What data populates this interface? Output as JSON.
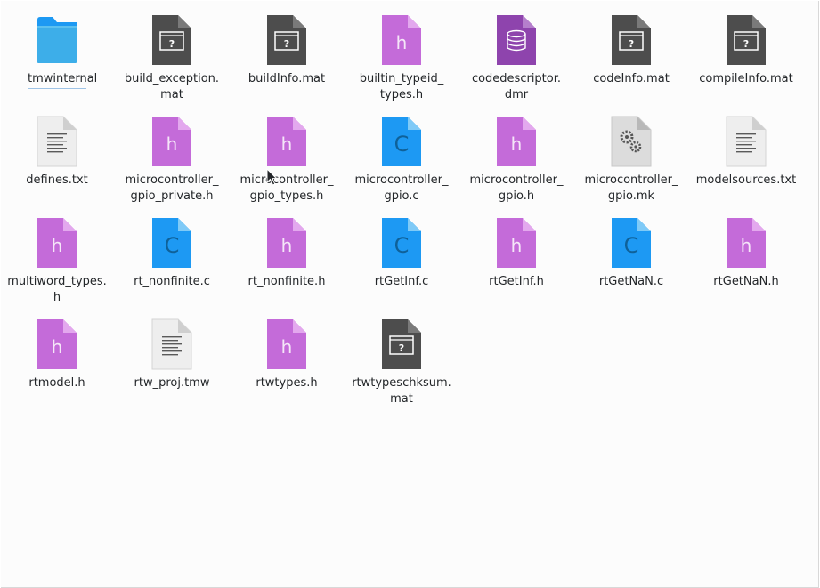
{
  "files": [
    {
      "name": "tmwinternal",
      "type": "folder"
    },
    {
      "name": "build_exception.\nmat",
      "type": "mat"
    },
    {
      "name": "buildInfo.mat",
      "type": "mat"
    },
    {
      "name": "builtin_typeid_\ntypes.h",
      "type": "h"
    },
    {
      "name": "codedescriptor.\ndmr",
      "type": "dmr"
    },
    {
      "name": "codeInfo.mat",
      "type": "mat"
    },
    {
      "name": "compileInfo.mat",
      "type": "mat"
    },
    {
      "name": "defines.txt",
      "type": "txt"
    },
    {
      "name": "microcontroller_\ngpio_private.h",
      "type": "h"
    },
    {
      "name": "microcontroller_\ngpio_types.h",
      "type": "h"
    },
    {
      "name": "microcontroller_\ngpio.c",
      "type": "c"
    },
    {
      "name": "microcontroller_\ngpio.h",
      "type": "h"
    },
    {
      "name": "microcontroller_\ngpio.mk",
      "type": "mk"
    },
    {
      "name": "modelsources.txt",
      "type": "txt"
    },
    {
      "name": "multiword_types.\nh",
      "type": "h"
    },
    {
      "name": "rt_nonfinite.c",
      "type": "c"
    },
    {
      "name": "rt_nonfinite.h",
      "type": "h"
    },
    {
      "name": "rtGetInf.c",
      "type": "c"
    },
    {
      "name": "rtGetInf.h",
      "type": "h"
    },
    {
      "name": "rtGetNaN.c",
      "type": "c"
    },
    {
      "name": "rtGetNaN.h",
      "type": "h"
    },
    {
      "name": "rtmodel.h",
      "type": "h"
    },
    {
      "name": "rtw_proj.tmw",
      "type": "txt"
    },
    {
      "name": "rtwtypes.h",
      "type": "h"
    },
    {
      "name": "rtwtypeschksum.\nmat",
      "type": "mat"
    }
  ],
  "icon_glyphs": {
    "h": "h",
    "c": "C",
    "mat": "?"
  },
  "icon_names": {
    "folder": "folder-icon",
    "mat": "unknown-file-icon",
    "h": "header-file-icon",
    "c": "c-source-file-icon",
    "txt": "text-file-icon",
    "dmr": "database-file-icon",
    "mk": "makefile-gear-icon"
  },
  "colors": {
    "folder": "#3daee9",
    "folder_tab": "#1d99f3",
    "mat": "#4d4d4d",
    "h": "#c46bd9",
    "c": "#1d99f3",
    "txt": "#eeeeee",
    "dmr": "#8e44ad",
    "mk": "#dcdcdc",
    "text": "#232629"
  },
  "current_item": 0
}
